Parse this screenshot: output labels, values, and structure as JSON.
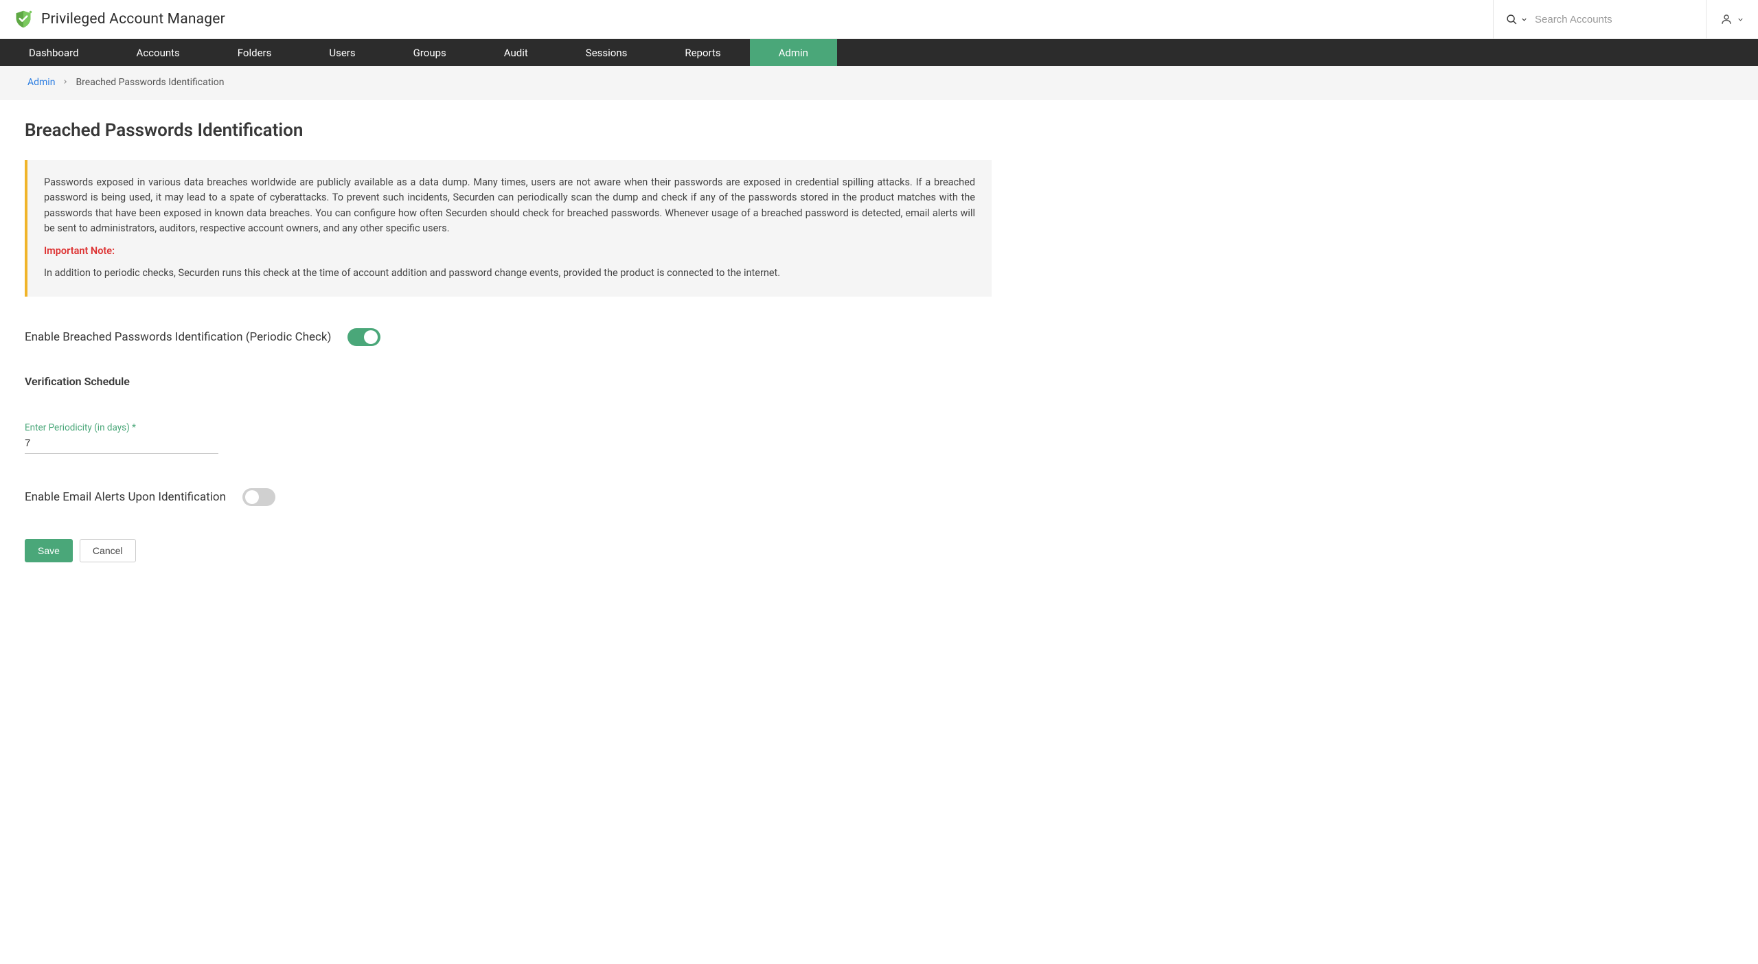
{
  "app": {
    "title": "Privileged Account Manager"
  },
  "search": {
    "placeholder": "Search Accounts"
  },
  "nav": {
    "items": [
      "Dashboard",
      "Accounts",
      "Folders",
      "Users",
      "Groups",
      "Audit",
      "Sessions",
      "Reports",
      "Admin"
    ],
    "active": "Admin"
  },
  "breadcrumb": {
    "root": "Admin",
    "current": "Breached Passwords Identification"
  },
  "page": {
    "title": "Breached Passwords Identification"
  },
  "infobox": {
    "paragraph1": "Passwords exposed in various data breaches worldwide are publicly available as a data dump. Many times, users are not aware when their passwords are exposed in credential spilling attacks. If a breached password is being used, it may lead to a spate of cyberattacks. To prevent such incidents, Securden can periodically scan the dump and check if any of the passwords stored in the product matches with the passwords that have been exposed in known data breaches. You can configure how often Securden should check for breached passwords. Whenever usage of a breached password is detected, email alerts will be sent to administrators, auditors, respective account owners, and any other specific users.",
    "important_label": "Important Note:",
    "paragraph2": "In addition to periodic checks, Securden runs this check at the time of account addition and password change events, provided the product is connected to the internet."
  },
  "settings": {
    "enable_periodic_label": "Enable Breached Passwords Identification (Periodic Check)",
    "enable_periodic_on": true,
    "schedule_title": "Verification Schedule",
    "periodicity_label": "Enter Periodicity (in days)",
    "periodicity_required": "*",
    "periodicity_value": "7",
    "enable_email_label": "Enable Email Alerts Upon Identification",
    "enable_email_on": false
  },
  "buttons": {
    "save": "Save",
    "cancel": "Cancel"
  }
}
